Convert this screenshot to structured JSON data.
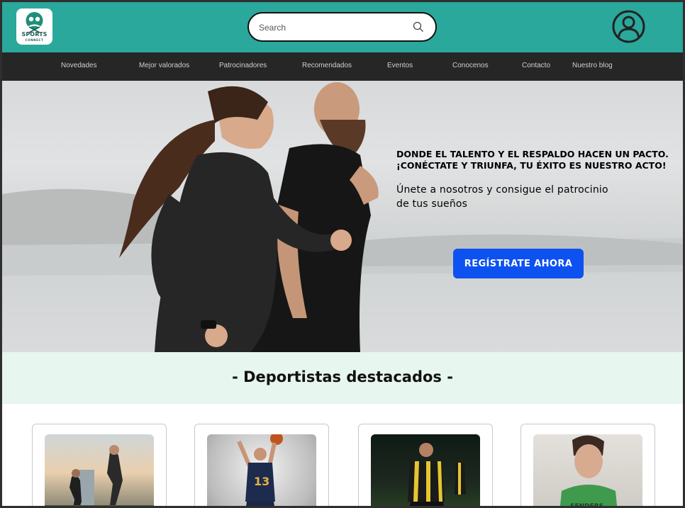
{
  "brand": {
    "logo_title": "SPORTS",
    "logo_subtitle": "CONNECT"
  },
  "search": {
    "placeholder": "Search"
  },
  "nav": {
    "items": [
      {
        "label": "Novedades"
      },
      {
        "label": "Mejor valorados"
      },
      {
        "label": "Patrocinadores"
      },
      {
        "label": "Recomendados"
      },
      {
        "label": "Eventos"
      },
      {
        "label": "Conocenos"
      },
      {
        "label": "Contacto"
      },
      {
        "label": "Nuestro blog"
      }
    ]
  },
  "hero": {
    "tagline_line1": "DONDE EL TALENTO Y EL RESPALDO HACEN UN PACTO.",
    "tagline_line2": "¡CONÉCTATE Y TRIUNFA, TU ÉXITO ES NUESTRO ACTO!",
    "subline_line1": "Únete a nosotros y consigue el patrocinio",
    "subline_line2": "de tus sueños",
    "cta_label": "REGÍSTRATE AHORA"
  },
  "featured": {
    "title": "- Deportistas destacados -",
    "cards": [
      {
        "photo": "runners-photo"
      },
      {
        "photo": "basketball-player-photo"
      },
      {
        "photo": "soccer-player-photo"
      },
      {
        "photo": "athlete-portrait-photo"
      }
    ]
  },
  "colors": {
    "header_bg": "#2aa89c",
    "nav_bg": "#262626",
    "cta_bg": "#0d52f0",
    "featured_bg": "#e7f6ee"
  },
  "icons": [
    "search-icon",
    "user-avatar-icon",
    "sports-connect-logo"
  ]
}
